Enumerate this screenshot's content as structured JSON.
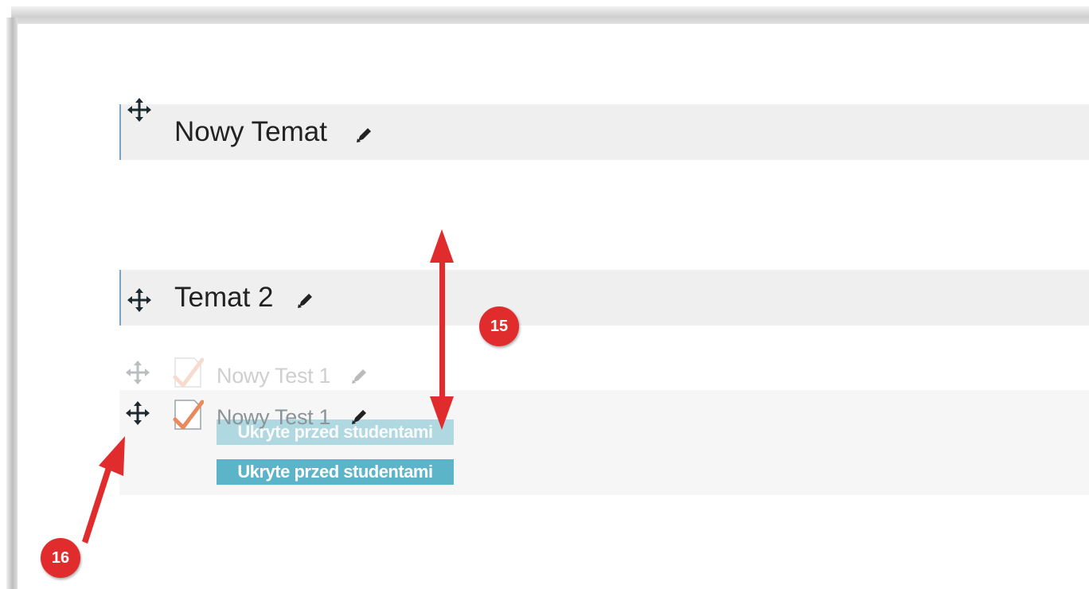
{
  "sections": [
    {
      "title": "Nowy Temat"
    },
    {
      "title": "Temat 2"
    }
  ],
  "activities": {
    "ghost": {
      "name": "Nowy Test 1",
      "badge": "Ukryte przed studentami"
    },
    "current": {
      "name": "Nowy Test 1",
      "badge": "Ukryte przed studentami"
    }
  },
  "callouts": [
    {
      "number": "15"
    },
    {
      "number": "16"
    }
  ],
  "colors": {
    "annotation_red": "#e02c2c",
    "badge_teal": "#5bb4c7",
    "section_border": "#7aa6c2",
    "section_bg": "#efefef"
  },
  "icons": {
    "move": "move-icon",
    "edit": "pencil-icon",
    "quiz": "quiz-icon"
  }
}
